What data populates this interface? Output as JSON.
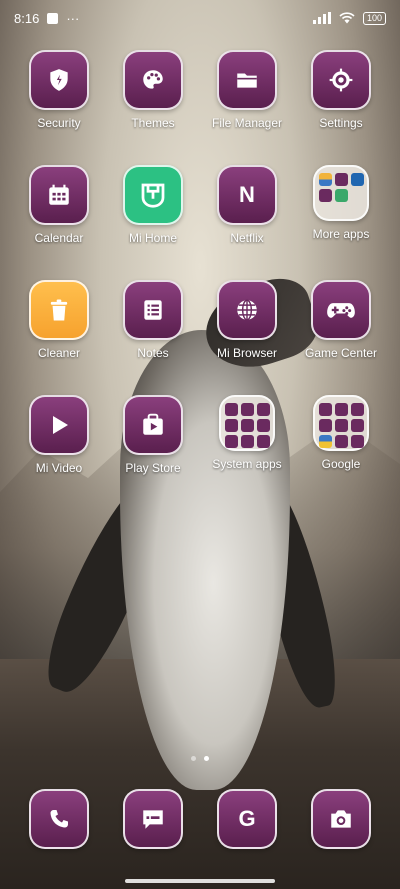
{
  "status_bar": {
    "time": "8:16",
    "more_indicator": "···",
    "battery": "100"
  },
  "apps": [
    {
      "label": "Security",
      "icon": "shield-icon"
    },
    {
      "label": "Themes",
      "icon": "palette-icon"
    },
    {
      "label": "File Manager",
      "icon": "folder-icon"
    },
    {
      "label": "Settings",
      "icon": "gear-icon"
    },
    {
      "label": "Calendar",
      "icon": "calendar-icon"
    },
    {
      "label": "Mi Home",
      "icon": "mihome-icon"
    },
    {
      "label": "Netflix",
      "icon": "netflix-icon",
      "glyph": "N"
    },
    {
      "label": "More apps",
      "icon": "folder-more-apps-icon"
    },
    {
      "label": "Cleaner",
      "icon": "trash-icon"
    },
    {
      "label": "Notes",
      "icon": "notes-icon"
    },
    {
      "label": "Mi Browser",
      "icon": "globe-icon"
    },
    {
      "label": "Game Center",
      "icon": "gamepad-icon"
    },
    {
      "label": "Mi Video",
      "icon": "play-icon"
    },
    {
      "label": "Play Store",
      "icon": "play-store-icon"
    },
    {
      "label": "System apps",
      "icon": "folder-system-apps-icon"
    },
    {
      "label": "Google",
      "icon": "folder-google-icon"
    }
  ],
  "dock": [
    {
      "name": "phone",
      "icon": "phone-icon"
    },
    {
      "name": "messages",
      "icon": "message-icon"
    },
    {
      "name": "google",
      "icon": "google-g-icon",
      "glyph": "G"
    },
    {
      "name": "camera",
      "icon": "camera-icon"
    }
  ],
  "page_indicator": {
    "pages": 2,
    "active": 2
  },
  "colors": {
    "icon_purple_top": "#8a3f7d",
    "icon_purple_bottom": "#5a1f4e",
    "mi_home_green": "#2cc183",
    "cleaner_orange": "#ffbf4d"
  }
}
